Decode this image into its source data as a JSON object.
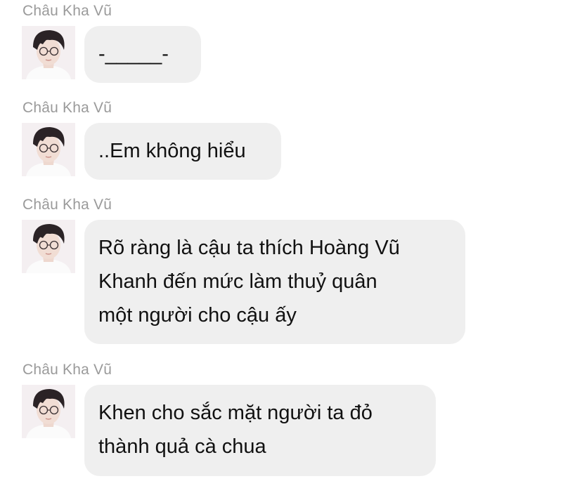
{
  "colors": {
    "background": "#ffffff",
    "bubble": "#efefef",
    "sender_name": "#9a9a9a",
    "message_text": "#111111"
  },
  "messages": [
    {
      "sender": "Châu Kha Vũ",
      "avatar_icon": "profile-photo-icon",
      "lines": [
        "-_____-"
      ]
    },
    {
      "sender": "Châu Kha Vũ",
      "avatar_icon": "profile-photo-icon",
      "lines": [
        "..Em không hiểu"
      ]
    },
    {
      "sender": "Châu Kha Vũ",
      "avatar_icon": "profile-photo-icon",
      "lines": [
        "Rõ ràng là cậu ta thích Hoàng Vũ",
        "Khanh đến mức làm thuỷ quân",
        "một người cho cậu ấy"
      ]
    },
    {
      "sender": "Châu Kha Vũ",
      "avatar_icon": "profile-photo-icon",
      "lines": [
        "Khen cho sắc mặt người ta đỏ",
        "thành quả cà chua"
      ]
    }
  ]
}
